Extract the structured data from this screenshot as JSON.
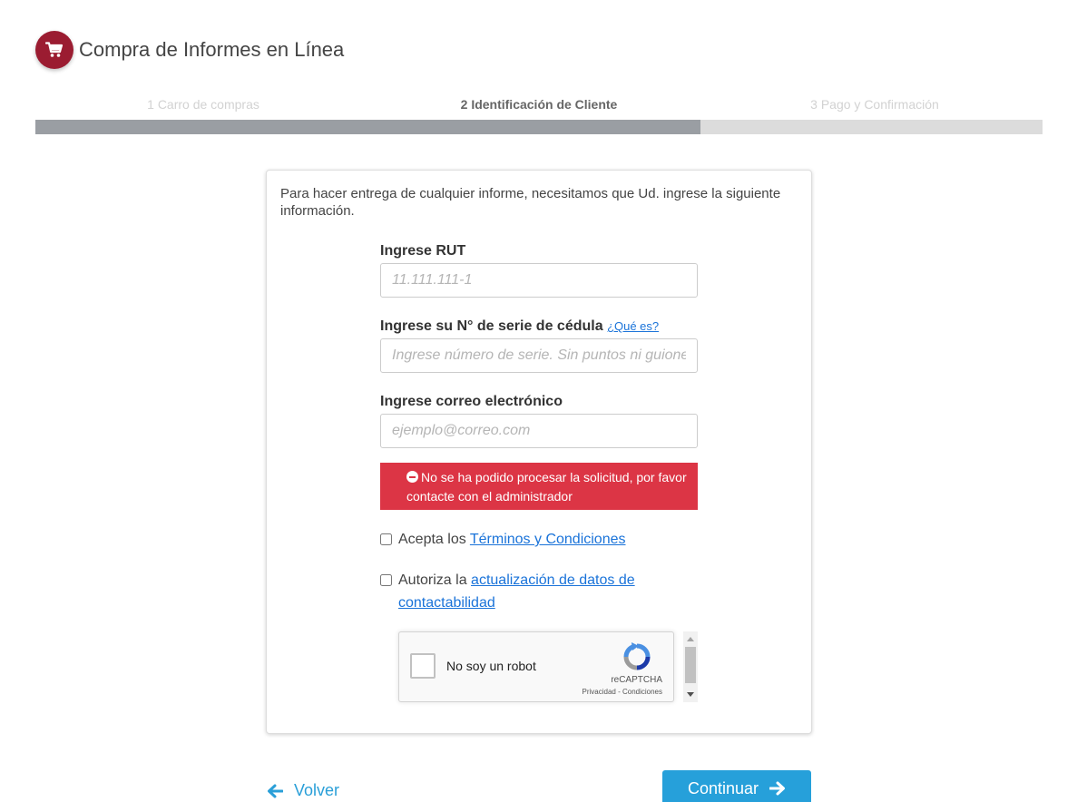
{
  "header": {
    "title": "Compra de Informes en Línea",
    "icon": "shopping-cart-icon",
    "brand_color": "#9b1c31"
  },
  "steps": [
    {
      "label": "1 Carro de compras",
      "state": "inactive"
    },
    {
      "label": "2 Identificación de Cliente",
      "state": "active"
    },
    {
      "label": "3 Pago y Confirmación",
      "state": "inactive"
    }
  ],
  "progress": {
    "fraction": 0.66
  },
  "form": {
    "intro": "Para hacer entrega de cualquier informe, necesitamos que Ud. ingrese la siguiente información.",
    "rut": {
      "label": "Ingrese RUT",
      "placeholder": "11.111.111-1",
      "value": ""
    },
    "serie": {
      "label": "Ingrese su N° de serie de cédula",
      "help_link": "¿Qué es?",
      "placeholder": "Ingrese número de serie. Sin puntos ni guiones",
      "value": ""
    },
    "email": {
      "label": "Ingrese correo electrónico",
      "placeholder": "ejemplo@correo.com",
      "value": ""
    },
    "error": {
      "message": "No se ha podido procesar la solicitud, por favor contacte con el administrador",
      "color": "#dc3545"
    },
    "terms": {
      "prefix": "Acepta los",
      "link": "Términos y Condiciones",
      "checked": false
    },
    "update": {
      "prefix": "Autoriza la",
      "link": "actualización de datos de contactabilidad",
      "checked": false
    },
    "captcha": {
      "label": "No soy un robot",
      "brand": "reCAPTCHA",
      "links": "Privacidad - Condiciones"
    }
  },
  "footer": {
    "back_label": "Volver",
    "continue_label": "Continuar",
    "accent_color": "#26a0da"
  }
}
